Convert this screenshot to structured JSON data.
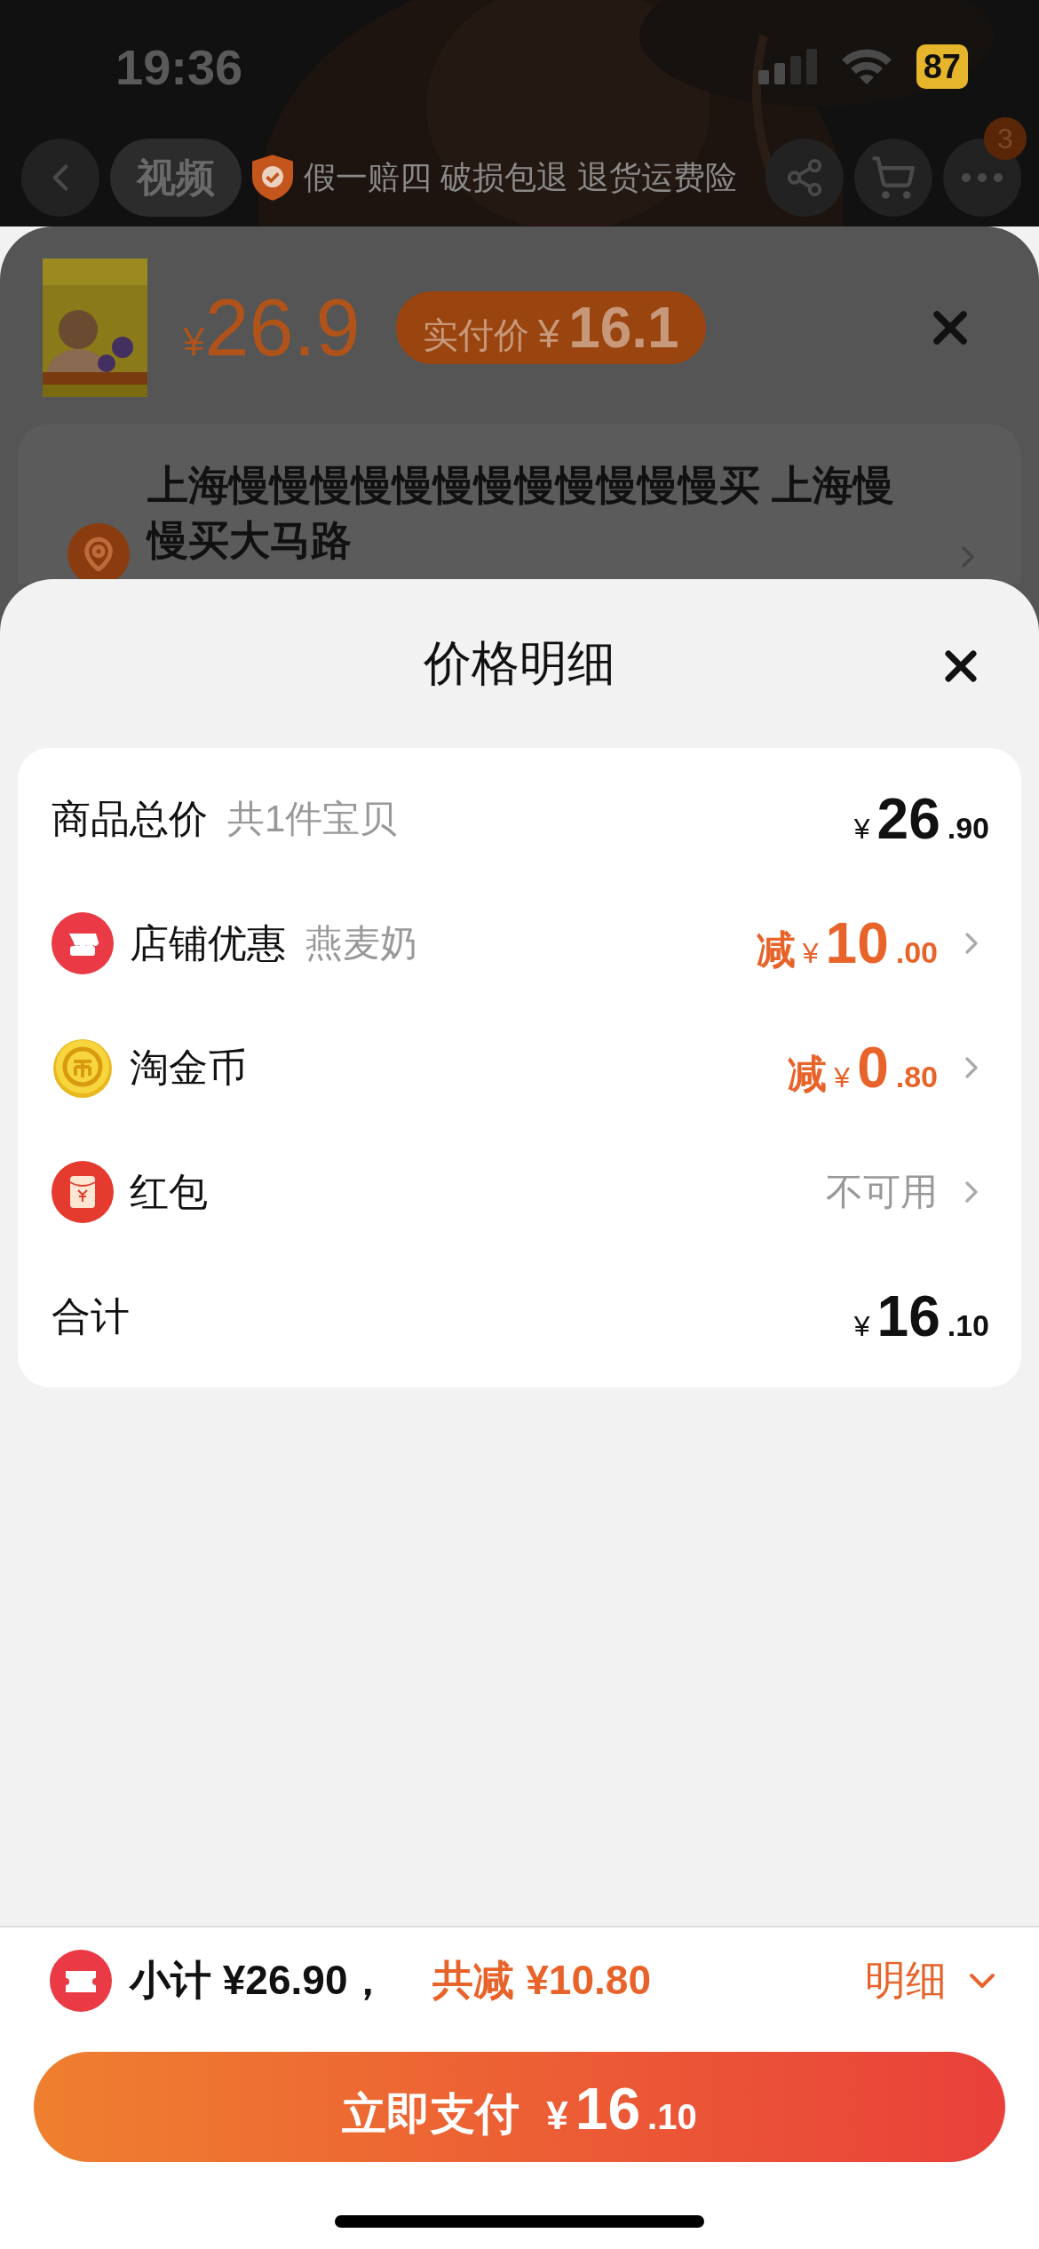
{
  "status_bar": {
    "time": "19:36",
    "battery": "87"
  },
  "nav": {
    "tabs": [
      {
        "label": "视频",
        "selected": true
      }
    ],
    "guarantee": "假一赔四 破损包退 退货运费险",
    "more_badge": "3"
  },
  "product": {
    "price": {
      "currency": "¥",
      "amount": "26.9"
    },
    "actual_price": {
      "label": "实付价",
      "currency": "¥",
      "amount": "16.1"
    }
  },
  "address": {
    "text": "上海慢慢慢慢慢慢慢慢慢慢慢慢买 上海慢慢买大马路"
  },
  "price_detail": {
    "title": "价格明细",
    "rows": [
      {
        "kind": "subtotal",
        "label": "商品总价",
        "note": "共1件宝贝",
        "value": {
          "currency": "¥",
          "integer": "26",
          "decimals": ".90"
        }
      },
      {
        "kind": "shop",
        "label": "店铺优惠",
        "note": "燕麦奶",
        "prefix": "减",
        "value": {
          "currency": "¥",
          "integer": "10",
          "decimals": ".00"
        }
      },
      {
        "kind": "coins",
        "label": "淘金币",
        "prefix": "减",
        "value": {
          "currency": "¥",
          "integer": "0",
          "decimals": ".80"
        }
      },
      {
        "kind": "packet",
        "label": "红包",
        "status": "不可用"
      },
      {
        "kind": "total",
        "label": "合计",
        "value": {
          "currency": "¥",
          "integer": "16",
          "decimals": ".10"
        }
      }
    ]
  },
  "footer": {
    "subtotal": "小计 ¥26.90，",
    "reduction": "共减 ¥10.80",
    "details": "明细",
    "pay_button": {
      "label": "立即支付",
      "currency": "¥",
      "integer": "16",
      "decimals": ".10"
    }
  }
}
